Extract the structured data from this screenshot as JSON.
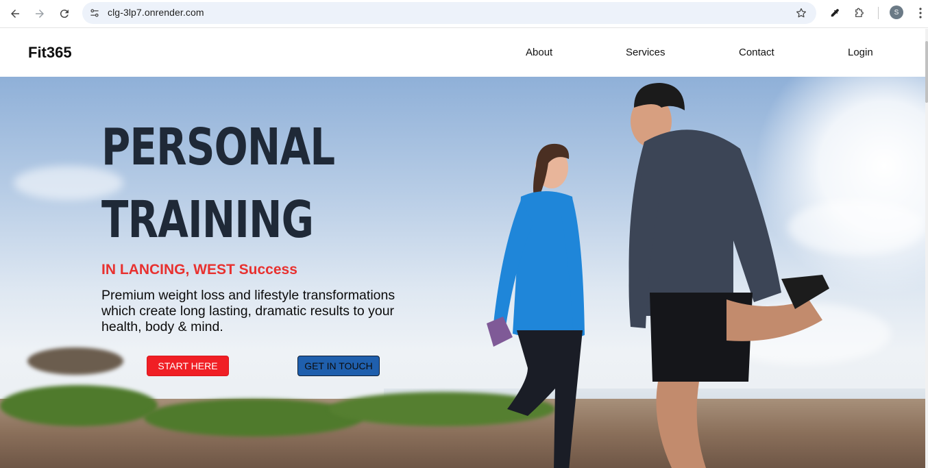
{
  "browser": {
    "url": "clg-3lp7.onrender.com",
    "avatar_letter": "S",
    "icons": [
      "back-arrow-icon",
      "forward-arrow-icon",
      "reload-icon",
      "site-info-icon",
      "bookmark-star-icon",
      "eyedropper-icon",
      "extensions-puzzle-icon",
      "kebab-menu-icon"
    ]
  },
  "header": {
    "logo": "Fit365",
    "nav": [
      {
        "label": "About"
      },
      {
        "label": "Services"
      },
      {
        "label": "Contact"
      },
      {
        "label": "Login"
      }
    ]
  },
  "hero": {
    "title_line1": "PERSONAL",
    "title_line2": "TRAINING",
    "subtitle": "IN LANCING, WEST Success",
    "description": "Premium weight loss and lifestyle transformations which create long lasting, dramatic results to your health, body & mind.",
    "cta_primary": "START HERE",
    "cta_secondary": "GET IN TOUCH"
  },
  "colors": {
    "accent_red": "#f01f25",
    "accent_blue": "#1f5fad",
    "heading_dark": "#1f2937",
    "subtitle_red": "#e8312f"
  }
}
